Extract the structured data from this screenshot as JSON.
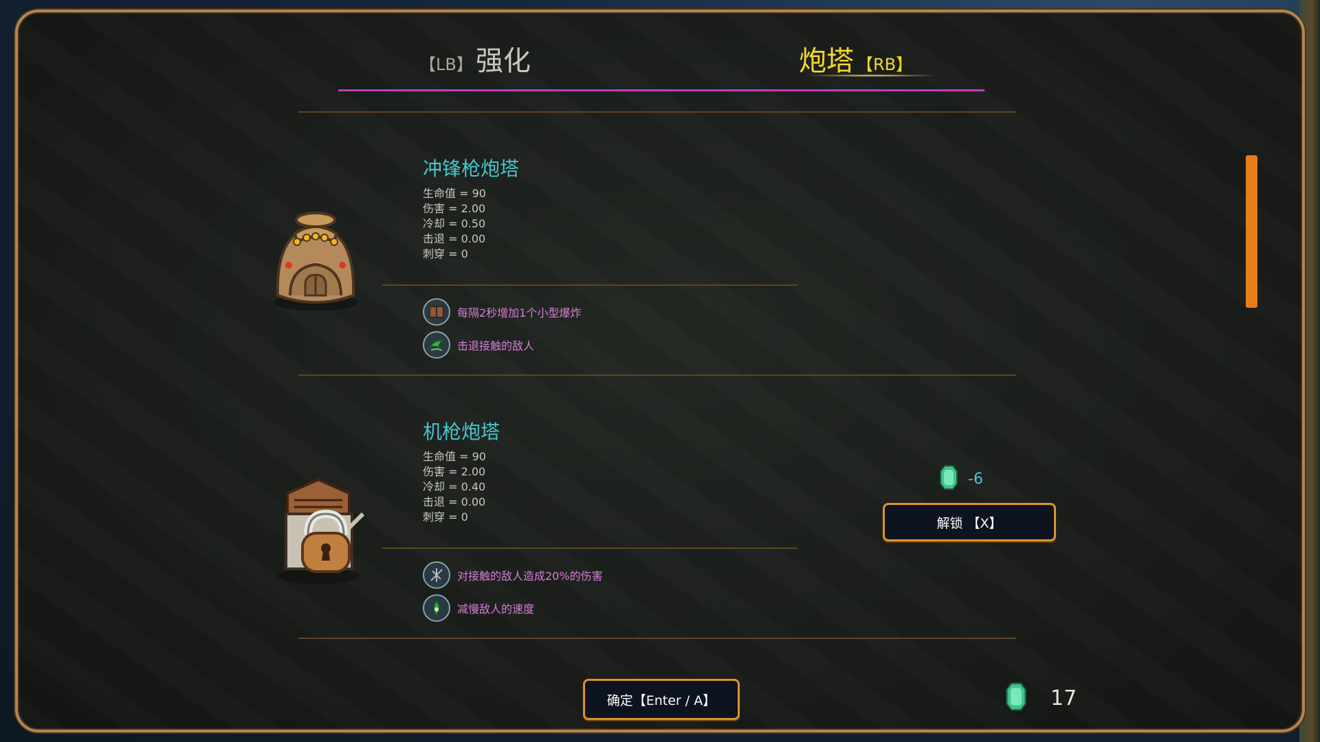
{
  "tabs": {
    "left": {
      "key_open": "【LB】",
      "label": "强化"
    },
    "right": {
      "label": "炮塔",
      "key_close": "【RB】"
    }
  },
  "turrets": [
    {
      "name": "冲锋枪炮塔",
      "stats": [
        "生命值 = 90",
        "伤害 = 2.00",
        "冷却 = 0.50",
        "击退 = 0.00",
        "刺穿 = 0"
      ],
      "perks": [
        {
          "text": "每隔2秒增加1个小型爆炸",
          "icon": "explosion-book-icon"
        },
        {
          "text": "击退接触的敌人",
          "icon": "green-swirl-icon"
        }
      ],
      "locked": false
    },
    {
      "name": "机枪炮塔",
      "stats": [
        "生命值 = 90",
        "伤害 = 2.00",
        "冷却 = 0.40",
        "击退 = 0.00",
        "刺穿 = 0"
      ],
      "perks": [
        {
          "text": "对接触的敌人造成20%的伤害",
          "icon": "thorns-icon"
        },
        {
          "text": "减慢敌人的速度",
          "icon": "slow-drop-icon"
        }
      ],
      "locked": true,
      "cost": "-6",
      "unlock_label": "解锁 【X】"
    }
  ],
  "footer": {
    "confirm_label": "确定【Enter / A】",
    "gem_count": "17"
  },
  "colors": {
    "accent_tab": "#f6d82a",
    "tab_underline": "#c03fb5",
    "turret_name": "#49c6cf",
    "perk_text": "#d37fd6",
    "button_border": "#e0922a",
    "scrollbar": "#e57e16"
  }
}
